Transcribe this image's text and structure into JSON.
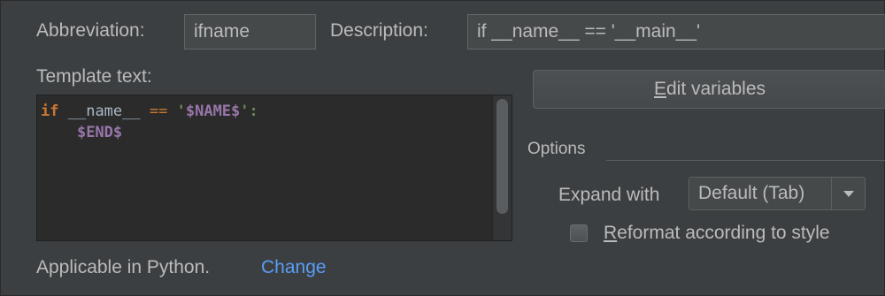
{
  "abbreviation": {
    "label": "Abbreviation:",
    "value": "ifname"
  },
  "description": {
    "label": "Description:",
    "value": "if __name__ == '__main__'"
  },
  "template": {
    "label": "Template text:",
    "code": {
      "kw_if": "if",
      "name_var": "__name__",
      "eq_op": "==",
      "quote_open": "'",
      "name_placeholder": "$NAME$",
      "quote_close_colon": "':",
      "end_placeholder": "$END$"
    }
  },
  "edit_variables": {
    "label_underlined": "E",
    "label_rest": "dit variables"
  },
  "options": {
    "title": "Options",
    "expand_with_label": "Expand with",
    "expand_with_value": "Default (Tab)",
    "reformat_checked": false,
    "reformat_underlined": "R",
    "reformat_rest": "eformat according to style"
  },
  "applicable": {
    "text": "Applicable in Python.",
    "link": "Change"
  }
}
